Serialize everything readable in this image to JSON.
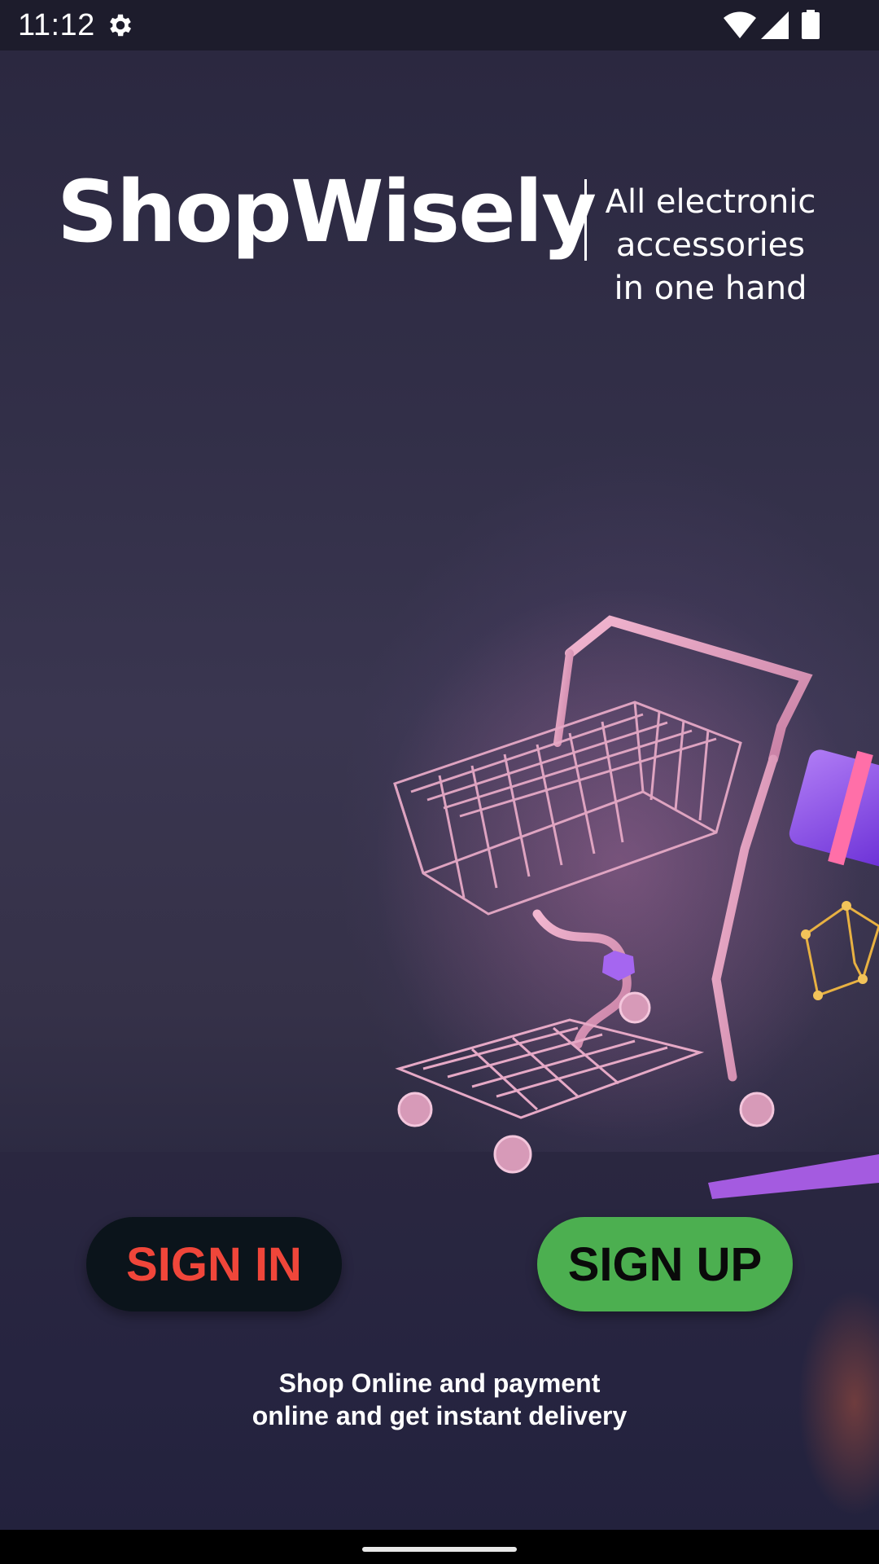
{
  "status_bar": {
    "time": "11:12",
    "icons": [
      "gear-icon",
      "wifi-icon",
      "signal-icon",
      "battery-icon"
    ]
  },
  "brand": {
    "name": "ShopWisely",
    "tagline_lines": [
      "All electronic",
      "accessories",
      "in one hand"
    ]
  },
  "buttons": {
    "sign_in": "SIGN IN",
    "sign_up": "SIGN UP"
  },
  "blurb_lines": [
    "Shop Online and payment",
    "online and get instant delivery"
  ],
  "colors": {
    "background": "#322f48",
    "sign_in_bg": "#0b141b",
    "sign_in_text": "#f0463a",
    "sign_up_bg": "#4caf50",
    "sign_up_text": "#0a0a0a"
  }
}
